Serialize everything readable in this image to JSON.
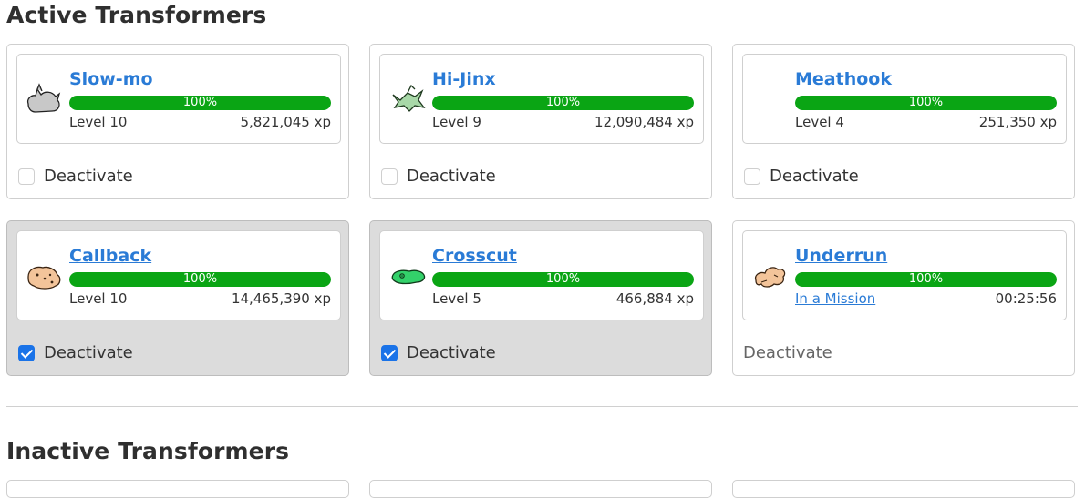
{
  "sections": {
    "active_title": "Active Transformers",
    "inactive_title": "Inactive Transformers"
  },
  "colors": {
    "link": "#2a7bd6",
    "progress": "#0aa514",
    "checkbox_checked": "#1a73e8",
    "selected_card": "#dcdcdc"
  },
  "active": [
    {
      "name": "Slow-mo",
      "progress": 1.0,
      "progress_label": "100%",
      "left": "Level 10",
      "right": "5,821,045 xp",
      "deactivate_label": "Deactivate",
      "checked": false,
      "icon": "slow-mo-icon"
    },
    {
      "name": "Hi-Jinx",
      "progress": 1.0,
      "progress_label": "100%",
      "left": "Level 9",
      "right": "12,090,484 xp",
      "deactivate_label": "Deactivate",
      "checked": false,
      "icon": "hi-jinx-icon"
    },
    {
      "name": "Meathook",
      "progress": 1.0,
      "progress_label": "100%",
      "left": "Level 4",
      "right": "251,350 xp",
      "deactivate_label": "Deactivate",
      "checked": false,
      "icon": "meathook-icon"
    },
    {
      "name": "Callback",
      "progress": 1.0,
      "progress_label": "100%",
      "left": "Level 10",
      "right": "14,465,390 xp",
      "deactivate_label": "Deactivate",
      "checked": true,
      "icon": "callback-icon"
    },
    {
      "name": "Crosscut",
      "progress": 1.0,
      "progress_label": "100%",
      "left": "Level 5",
      "right": "466,884 xp",
      "deactivate_label": "Deactivate",
      "checked": true,
      "icon": "crosscut-icon"
    },
    {
      "name": "Underrun",
      "progress": 1.0,
      "progress_label": "100%",
      "left": "In a Mission",
      "right": "00:25:56",
      "deactivate_label": "Deactivate",
      "checked": false,
      "in_mission": true,
      "icon": "underrun-icon"
    }
  ]
}
